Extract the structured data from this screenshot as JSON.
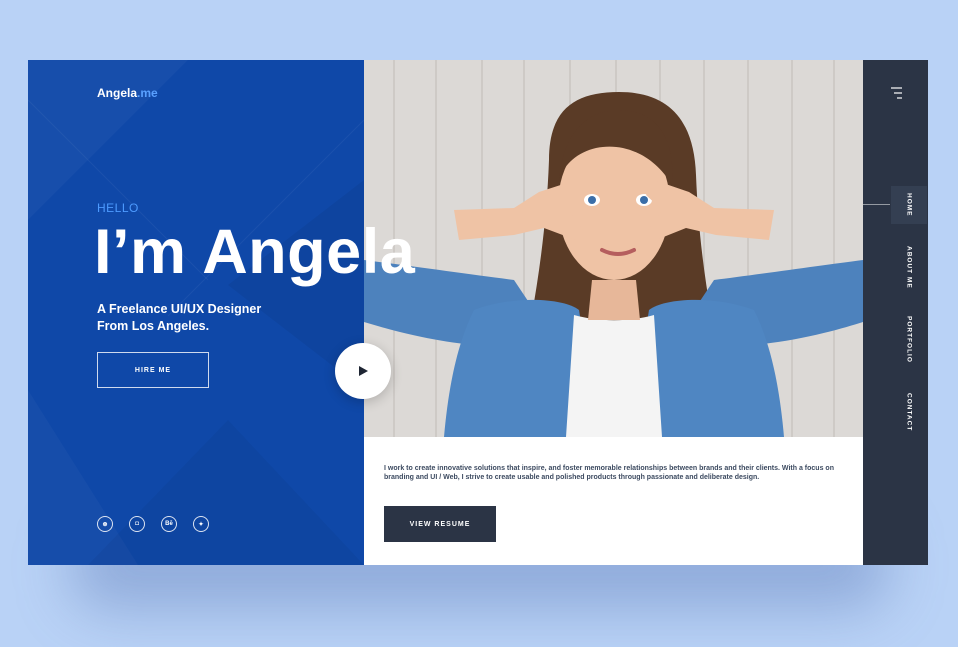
{
  "brand": {
    "name": "Angela",
    "suffix": ".me"
  },
  "hero": {
    "greeting": "HELLO",
    "headline": "I’m Angela",
    "subtitle_line1": "A Freelance UI/UX Designer",
    "subtitle_line2": "From Los Angeles.",
    "hire_label": "HIRE ME"
  },
  "socials": [
    {
      "icon": "dribbble-icon",
      "glyph": "⊛"
    },
    {
      "icon": "instagram-icon",
      "glyph": "◘"
    },
    {
      "icon": "behance-icon",
      "glyph": "Bē"
    },
    {
      "icon": "twitter-icon",
      "glyph": "✦"
    }
  ],
  "about": {
    "text": "I work to create innovative solutions that inspire, and foster memorable relationships between brands and their clients. With a focus on branding and UI / Web, I strive to create usable and polished products through passionate and deliberate design.",
    "resume_label": "VIEW RESUME"
  },
  "nav": {
    "items": [
      {
        "label": "HOME",
        "active": true
      },
      {
        "label": "ABOUT ME",
        "active": false
      },
      {
        "label": "PORTFOLIO",
        "active": false
      },
      {
        "label": "CONTACT",
        "active": false
      }
    ]
  },
  "colors": {
    "page_bg": "#b9d2f6",
    "hero_blue": "#0f48a8",
    "accent": "#4d9bff",
    "sidebar": "#2b3445",
    "button_dark": "#2b3445"
  }
}
